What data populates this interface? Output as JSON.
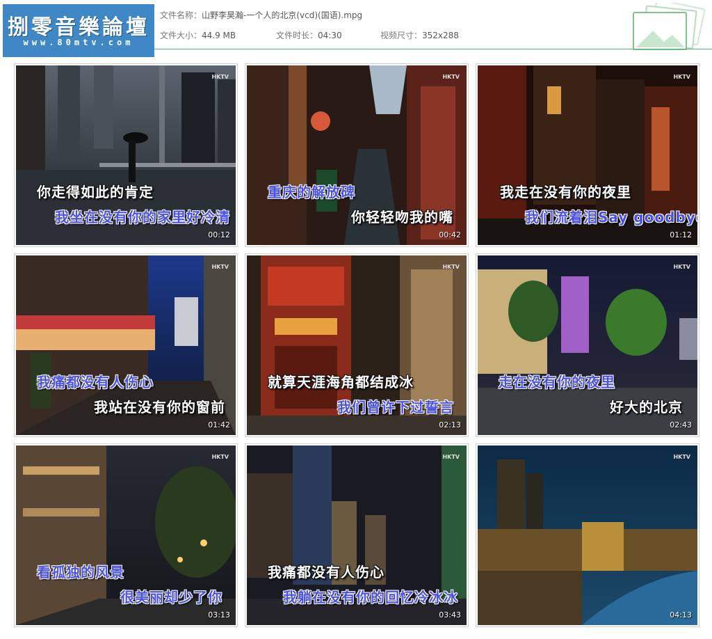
{
  "header": {
    "logo_title": "捌零音樂論壇",
    "logo_url": "www.80mtv.com",
    "file_name_label": "文件名称：",
    "file_name": "山野李昊瀚-一个人的北京(vcd)(国语).mpg",
    "file_size_label": "文件大小：",
    "file_size": "44.9 MB",
    "duration_label": "文件时长：",
    "duration": "04:30",
    "video_size_label": "视频尺寸：",
    "video_size": "352x288"
  },
  "watermark": "HKTV",
  "thumbnails": [
    {
      "time": "00:12",
      "line1": "你走得如此的肯定",
      "line2": "我坐在没有你的家里好冷清"
    },
    {
      "time": "00:42",
      "line1": "重庆的解放碑",
      "line2": "你轻轻吻我的嘴"
    },
    {
      "time": "01:12",
      "line1": "我走在没有你的夜里",
      "line2": "我们流着泪Say goodbye"
    },
    {
      "time": "01:42",
      "line1": "我痛都没有人伤心",
      "line2": "我站在没有你的窗前"
    },
    {
      "time": "02:13",
      "line1": "就算天涯海角都结成冰",
      "line2": "我们曾许下过誓言"
    },
    {
      "time": "02:43",
      "line1": "走在没有你的夜里",
      "line2": "好大的北京"
    },
    {
      "time": "03:13",
      "line1": "看孤独的风景",
      "line2": "很美丽却少了你"
    },
    {
      "time": "03:43",
      "line1": "我痛都没有人伤心",
      "line2": "我躺在没有你的回忆冷冰冰"
    },
    {
      "time": "04:13",
      "line1": "",
      "line2": ""
    }
  ],
  "colors": {
    "accent_rule": "#59b46b",
    "logo_bg": "#3f88c5",
    "lyric_blue": "#4b52e0"
  }
}
